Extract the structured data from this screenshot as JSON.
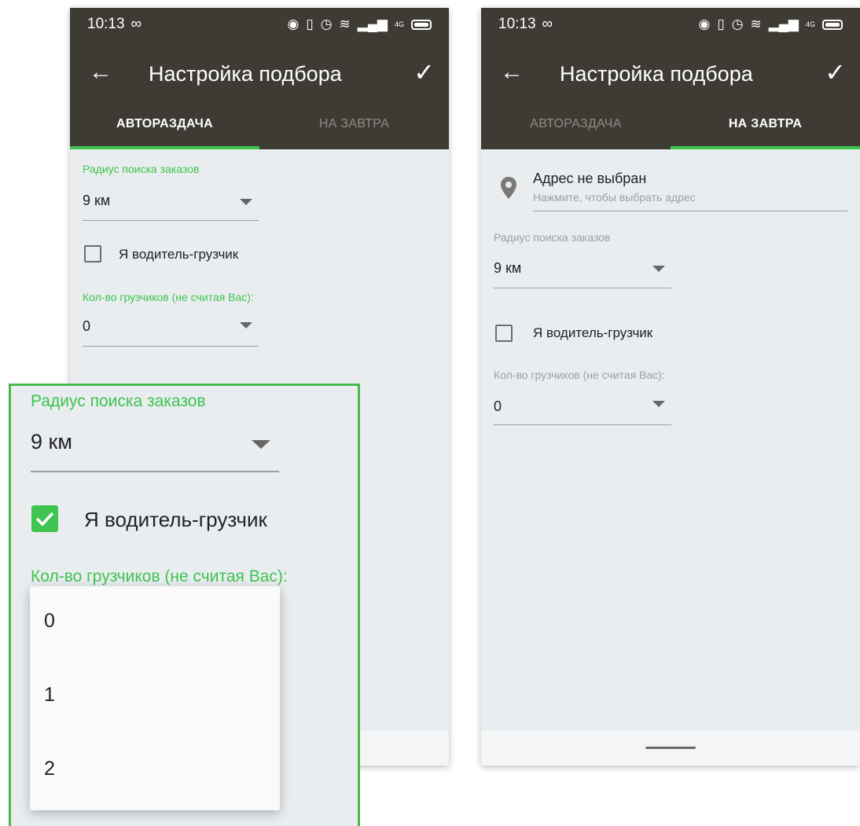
{
  "status_bar": {
    "time": "10:13",
    "infinity_glyph": "∞",
    "network": "4G"
  },
  "left_screen": {
    "app_bar": {
      "back_glyph": "←",
      "title": "Настройка подбора",
      "confirm_glyph": "✓"
    },
    "tabs": [
      {
        "label": "АВТОРАЗДАЧА",
        "active": true
      },
      {
        "label": "НА ЗАВТРА",
        "active": false
      }
    ],
    "radius": {
      "label": "Радиус поиска заказов",
      "value": "9 км"
    },
    "loader_checkbox": {
      "label": "Я водитель-грузчик",
      "checked": false
    },
    "loaders_count": {
      "label": "Кол-во грузчиков (не считая Вас):",
      "value": "0"
    }
  },
  "right_screen": {
    "app_bar": {
      "back_glyph": "←",
      "title": "Настройка подбора",
      "confirm_glyph": "✓"
    },
    "tabs": [
      {
        "label": "АВТОРАЗДАЧА",
        "active": false
      },
      {
        "label": "НА ЗАВТРА",
        "active": true
      }
    ],
    "address": {
      "title": "Адрес не выбран",
      "hint": "Нажмите, чтобы выбрать адрес",
      "icon": "location-pin-icon"
    },
    "radius": {
      "label": "Радиус поиска заказов",
      "value": "9 км"
    },
    "loader_checkbox": {
      "label": "Я водитель-грузчик",
      "checked": false
    },
    "loaders_count": {
      "label": "Кол-во грузчиков (не считая Вас):",
      "value": "0"
    }
  },
  "zoom_panel": {
    "radius": {
      "label": "Радиус поиска заказов",
      "value": "9 км"
    },
    "loader_checkbox": {
      "label": "Я водитель-грузчик",
      "checked": true
    },
    "loaders_count": {
      "label": "Кол-во грузчиков (не считая Вас):"
    },
    "dropdown_options": [
      "0",
      "1",
      "2"
    ]
  },
  "colors": {
    "app_bar": "#3e3b35",
    "accent": "#3ec44f",
    "background": "#e9edf0",
    "highlight_border": "#4ab84c"
  }
}
